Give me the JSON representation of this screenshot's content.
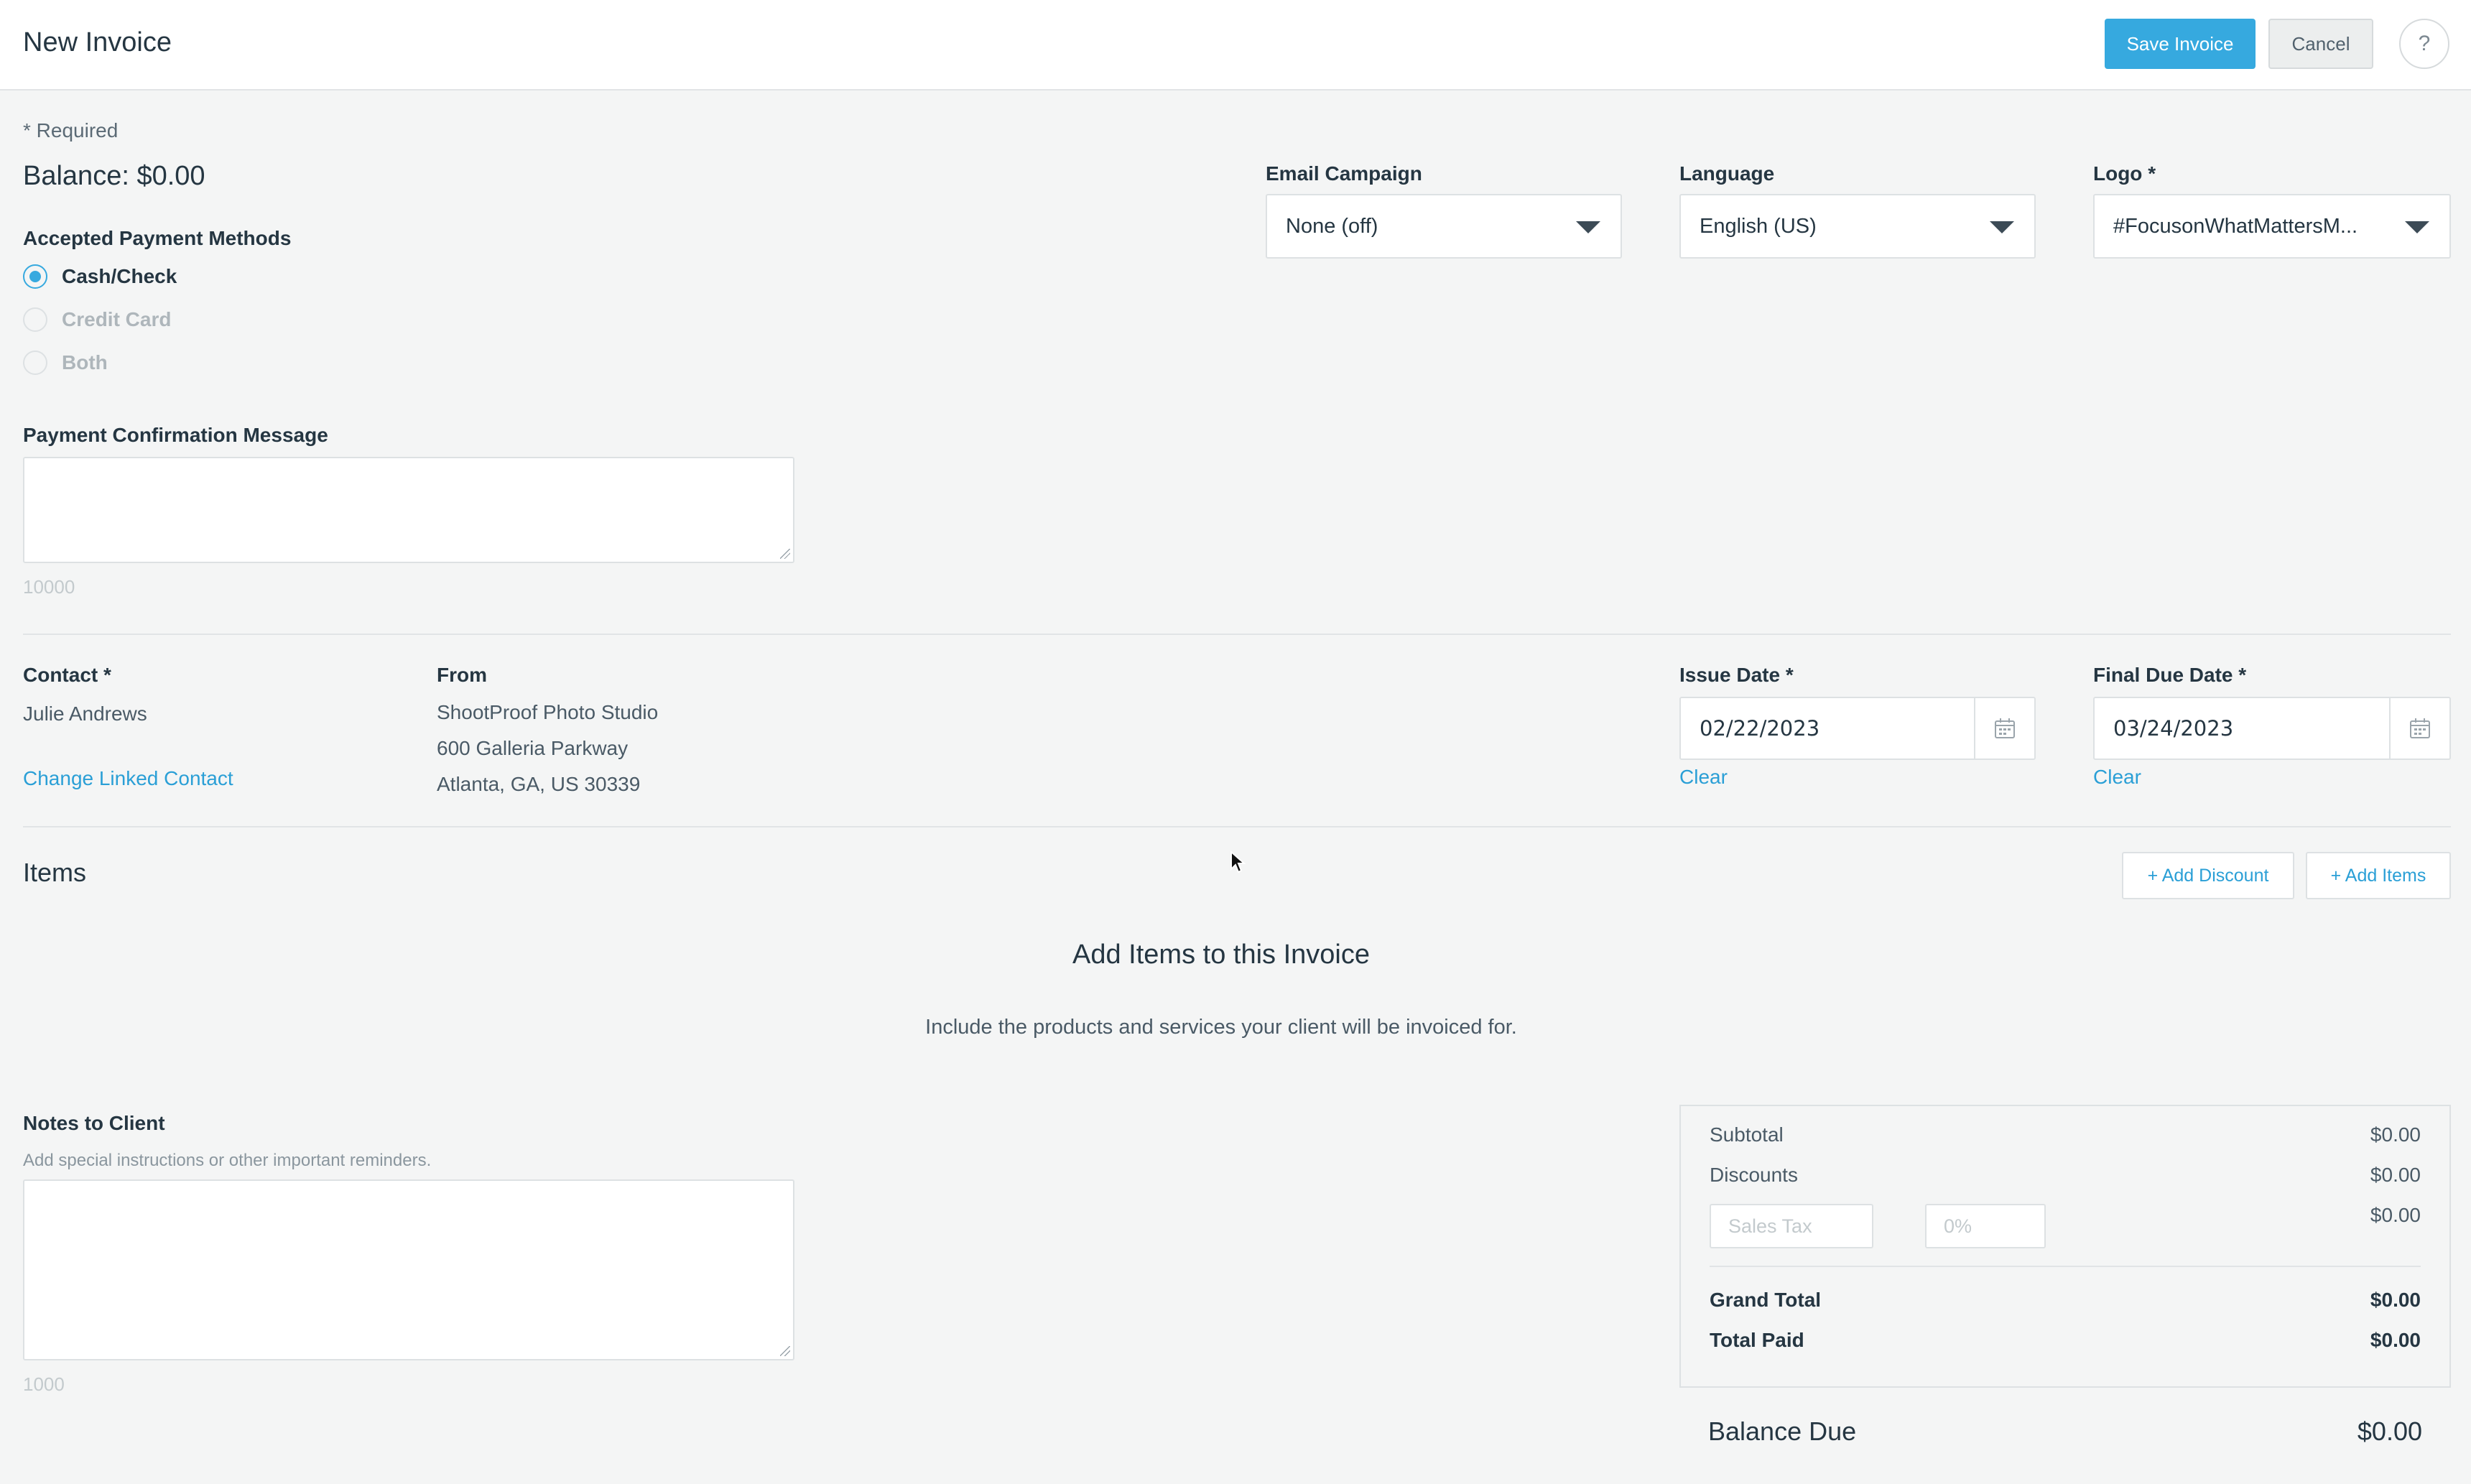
{
  "header": {
    "title": "New Invoice",
    "save_label": "Save Invoice",
    "cancel_label": "Cancel",
    "help_label": "?"
  },
  "form": {
    "required_note": "* Required",
    "balance": "Balance: $0.00",
    "payment_methods": {
      "label": "Accepted Payment Methods",
      "options": [
        {
          "label": "Cash/Check",
          "checked": true
        },
        {
          "label": "Credit Card",
          "checked": false
        },
        {
          "label": "Both",
          "checked": false
        }
      ]
    },
    "confirmation_message": {
      "label": "Payment Confirmation Message",
      "value": "",
      "char_limit": "10000"
    },
    "email_campaign": {
      "label": "Email Campaign",
      "selected": "None (off)"
    },
    "language": {
      "label": "Language",
      "selected": "English (US)"
    },
    "logo": {
      "label": "Logo *",
      "selected": "#FocusonWhatMattersM..."
    }
  },
  "contact": {
    "label": "Contact *",
    "name": "Julie Andrews",
    "change_link": "Change Linked Contact"
  },
  "from": {
    "label": "From",
    "line1": "ShootProof Photo Studio",
    "line2": "600 Galleria Parkway",
    "line3": "Atlanta, GA, US 30339"
  },
  "issue_date": {
    "label": "Issue Date *",
    "value": "02/22/2023",
    "clear": "Clear"
  },
  "due_date": {
    "label": "Final Due Date *",
    "value": "03/24/2023",
    "clear": "Clear"
  },
  "items": {
    "title": "Items",
    "add_discount": "+ Add Discount",
    "add_items": "+ Add Items",
    "empty_title": "Add Items to this Invoice",
    "empty_subtitle": "Include the products and services your client will be invoiced for."
  },
  "notes": {
    "label": "Notes to Client",
    "hint": "Add special instructions or other important reminders.",
    "value": "",
    "char_limit": "1000"
  },
  "summary": {
    "subtotal_label": "Subtotal",
    "subtotal": "$0.00",
    "discounts_label": "Discounts",
    "discounts": "$0.00",
    "sales_tax_placeholder": "Sales Tax",
    "tax_rate_placeholder": "0%",
    "tax_amount": "$0.00",
    "grand_total_label": "Grand Total",
    "grand_total": "$0.00",
    "total_paid_label": "Total Paid",
    "total_paid": "$0.00",
    "balance_due_label": "Balance Due",
    "balance_due": "$0.00"
  },
  "colors": {
    "accent": "#36a9df",
    "link": "#2a9fd6",
    "background": "#f4f5f5"
  }
}
